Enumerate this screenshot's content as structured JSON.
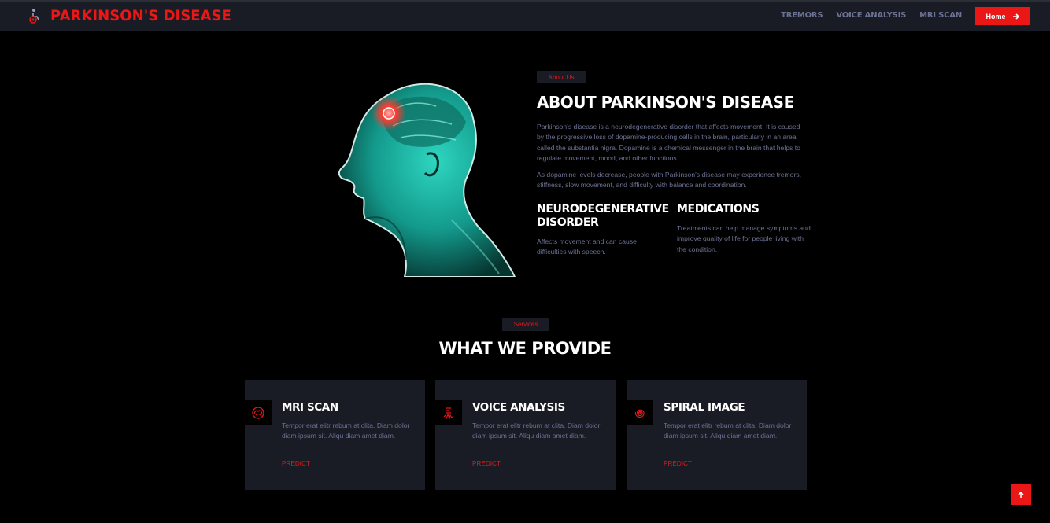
{
  "brand": {
    "title": "PARKINSON'S DISEASE",
    "icon": "wheelchair-icon"
  },
  "nav": {
    "links": [
      "TREMORS",
      "VOICE ANALYSIS",
      "MRI SCAN"
    ],
    "home_label": "Home",
    "home_icon": "arrow-right-icon"
  },
  "about": {
    "tag": "About Us",
    "title": "ABOUT PARKINSON'S DISEASE",
    "paragraph1": "Parkinson's disease is a neurodegenerative disorder that affects movement. It is caused by the progressive loss of dopamine-producing cells in the brain, particularly in an area called the substantia nigra. Dopamine is a chemical messenger in the brain that helps to regulate movement, mood, and other functions.",
    "paragraph2": "As dopamine levels decrease, people with Parkinson's disease may experience tremors, stiffness, slow movement, and difficulty with balance and coordination.",
    "features": [
      {
        "title": "NEURODEGENERATIVE DISORDER",
        "text": "Affects movement and can cause difficulties with speech."
      },
      {
        "title": "MEDICATIONS",
        "text": "Treatments can help manage symptoms and improve quality of life for people living with the condition."
      }
    ]
  },
  "services": {
    "tag": "Services",
    "title": "WHAT WE PROVIDE",
    "cards": [
      {
        "title": "MRI SCAN",
        "text": "Tempor erat elitr rebum at clita. Diam dolor diam ipsum sit. Aliqu diam amet diam.",
        "link": "PREDICT",
        "icon": "brain-scan-icon"
      },
      {
        "title": "VOICE ANALYSIS",
        "text": "Tempor erat elitr rebum at clita. Diam dolor diam ipsum sit. Aliqu diam amet diam.",
        "link": "PREDICT",
        "icon": "voice-wave-icon"
      },
      {
        "title": "SPIRAL IMAGE",
        "text": "Tempor erat elitr rebum at clita. Diam dolor diam ipsum sit. Aliqu diam amet diam.",
        "link": "PREDICT",
        "icon": "spiral-icon"
      }
    ]
  },
  "colors": {
    "accent": "#EB1616",
    "panel": "#191C24",
    "muted_text": "#6C7293",
    "background": "#000000"
  },
  "back_to_top_icon": "arrow-up-icon"
}
